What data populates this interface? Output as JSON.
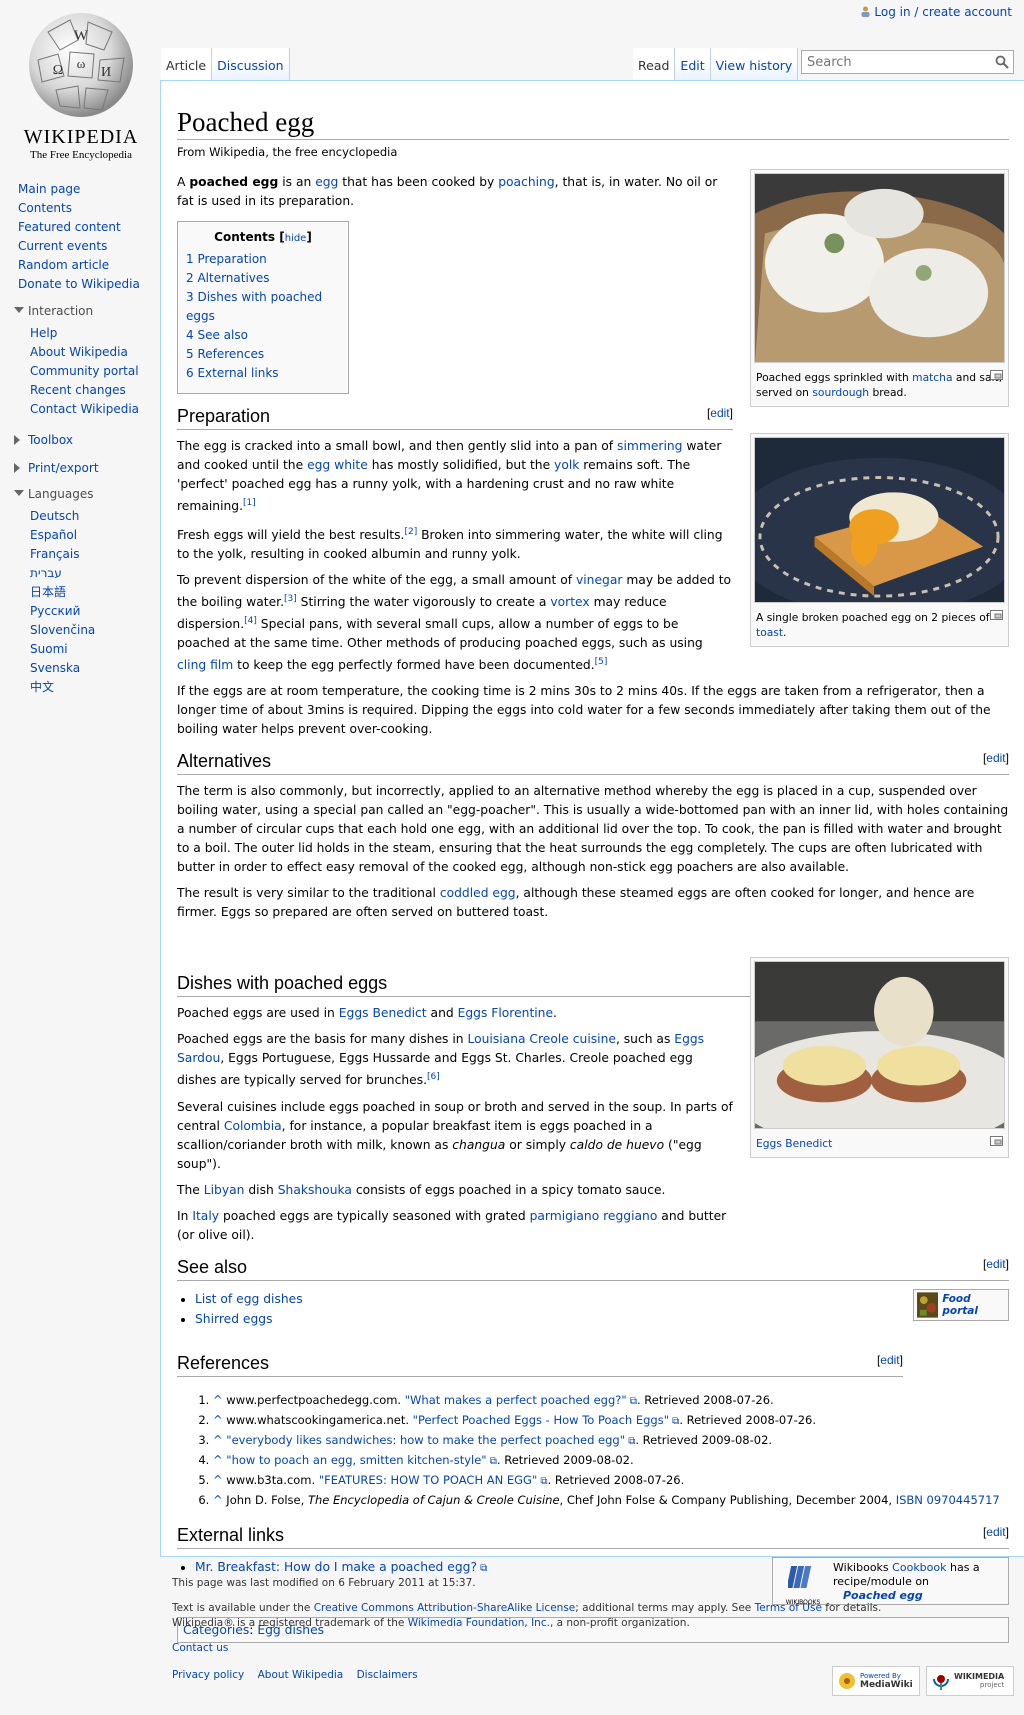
{
  "user": {
    "login": "Log in / create account"
  },
  "logo": {
    "wordmark": "Wikipedia",
    "tagline": "The Free Encyclopedia"
  },
  "tabs": {
    "article": "Article",
    "discussion": "Discussion",
    "read": "Read",
    "edit": "Edit",
    "history": "View history"
  },
  "search": {
    "placeholder": "Search"
  },
  "sidebar": {
    "nav": [
      "Main page",
      "Contents",
      "Featured content",
      "Current events",
      "Random article",
      "Donate to Wikipedia"
    ],
    "interaction_label": "Interaction",
    "interaction": [
      "Help",
      "About Wikipedia",
      "Community portal",
      "Recent changes",
      "Contact Wikipedia"
    ],
    "toolbox": "Toolbox",
    "printexport": "Print/export",
    "languages_label": "Languages",
    "languages": [
      "Deutsch",
      "Español",
      "Français",
      "עברית",
      "日本語",
      "Русский",
      "Slovenčina",
      "Suomi",
      "Svenska",
      "中文"
    ]
  },
  "article": {
    "title": "Poached egg",
    "sub": "From Wikipedia, the free encyclopedia",
    "edit": "edit",
    "intro": {
      "a": "A ",
      "b": "poached egg",
      "c": " is an ",
      "d": "egg",
      "e": " that has been cooked by ",
      "f": "poaching",
      "g": ", that is, in water. No oil or fat is used in its preparation."
    },
    "toc": {
      "title": "Contents",
      "hide": "hide",
      "items": [
        "1 Preparation",
        "2 Alternatives",
        "3 Dishes with poached eggs",
        "4 See also",
        "5 References",
        "6 External links"
      ]
    },
    "prep": {
      "heading": "Preparation",
      "p1": {
        "a": "The egg is cracked into a small bowl, and then gently slid into a pan of ",
        "b": "simmering",
        "c": " water and cooked until the ",
        "d": "egg white",
        "e": " has mostly solidified, but the ",
        "f": "yolk",
        "g": " remains soft. The 'perfect' poached egg has a runny yolk, with a hardening crust and no raw white remaining.",
        "s": "[1]"
      },
      "p2": {
        "a": "Fresh eggs will yield the best results.",
        "s": "[2]",
        "b": " Broken into simmering water, the white will cling to the yolk, resulting in cooked albumin and runny yolk."
      },
      "p3": {
        "a": "To prevent dispersion of the white of the egg, a small amount of ",
        "b": "vinegar",
        "c": " may be added to the boiling water.",
        "s3": "[3]",
        "d": " Stirring the water vigorously to create a ",
        "e": "vortex",
        "f": " may reduce dispersion.",
        "s4": "[4]",
        "g": " Special pans, with several small cups, allow a number of eggs to be poached at the same time. Other methods of producing poached eggs, such as using ",
        "h": "cling film",
        "i": " to keep the egg perfectly formed have been documented.",
        "s5": "[5]"
      },
      "p4": "If the eggs are at room temperature, the cooking time is 2 mins 30s to 2 mins 40s. If the eggs are taken from a refrigerator, then a longer time of about 3mins is required. Dipping the eggs into cold water for a few seconds immediately after taking them out of the boiling water helps prevent over-cooking."
    },
    "alt": {
      "heading": "Alternatives",
      "p1": "The term is also commonly, but incorrectly, applied to an alternative method whereby the egg is placed in a cup, suspended over boiling water, using a special pan called an \"egg-poacher\". This is usually a wide-bottomed pan with an inner lid, with holes containing a number of circular cups that each hold one egg, with an additional lid over the top. To cook, the pan is filled with water and brought to a boil. The outer lid holds in the steam, ensuring that the heat surrounds the egg completely. The cups are often lubricated with butter in order to effect easy removal of the cooked egg, although non-stick egg poachers are also available.",
      "p2": {
        "a": "The result is very similar to the traditional ",
        "b": "coddled egg",
        "c": ", although these steamed eggs are often cooked for longer, and hence are firmer. Eggs so prepared are often served on buttered toast."
      }
    },
    "dishes": {
      "heading": "Dishes with poached eggs",
      "p1": {
        "a": "Poached eggs are used in ",
        "b": "Eggs Benedict",
        "c": " and ",
        "d": "Eggs Florentine",
        "e": "."
      },
      "p2": {
        "a": "Poached eggs are the basis for many dishes in ",
        "b": "Louisiana Creole cuisine",
        "c": ", such as ",
        "d": "Eggs Sardou",
        "e": ", Eggs Portuguese, Eggs Hussarde and Eggs St. Charles. Creole poached egg dishes are typically served for brunches.",
        "s": "[6]"
      },
      "p3": {
        "a": "Several cuisines include eggs poached in soup or broth and served in the soup. In parts of central ",
        "b": "Colombia",
        "c": ", for instance, a popular breakfast item is eggs poached in a scallion/coriander broth with milk, known as ",
        "d": "changua",
        "e": " or simply ",
        "f": "caldo de huevo",
        "g": " (\"egg soup\")."
      },
      "p4": {
        "a": "The ",
        "b": "Libyan",
        "c": " dish ",
        "d": "Shakshouka",
        "e": " consists of eggs poached in a spicy tomato sauce."
      },
      "p5": {
        "a": "In ",
        "b": "Italy",
        "c": " poached eggs are typically seasoned with grated ",
        "d": "parmigiano reggiano",
        "e": " and butter (or olive oil)."
      }
    },
    "see": {
      "heading": "See also",
      "items": [
        "List of egg dishes",
        "Shirred eggs"
      ],
      "portal": "Food portal"
    },
    "refs": {
      "heading": "References",
      "items": [
        {
          "pre": "www.perfectpoachedegg.com. ",
          "link": "\"What makes a perfect poached egg?\"",
          "post": ". Retrieved 2008-07-26."
        },
        {
          "pre": "www.whatscookingamerica.net. ",
          "link": "\"Perfect Poached Eggs - How To Poach Eggs\"",
          "post": ". Retrieved 2008-07-26."
        },
        {
          "pre": "",
          "link": "\"everybody likes sandwiches: how to make the perfect poached egg\"",
          "post": ". Retrieved 2009-08-02."
        },
        {
          "pre": "",
          "link": "\"how to poach an egg, smitten kitchen-style\"",
          "post": ". Retrieved 2009-08-02."
        },
        {
          "pre": "www.b3ta.com. ",
          "link": "\"FEATURES: HOW TO POACH AN EGG\"",
          "post": ". Retrieved 2008-07-26."
        }
      ],
      "r6": {
        "a": "John D. Folse, ",
        "b": "The Encyclopedia of Cajun & Creole Cuisine",
        "c": ", Chef John Folse & Company Publishing, December 2004, ",
        "d": "ISBN 0970445717"
      },
      "caret": "^"
    },
    "ext": {
      "heading": "External links",
      "item": "Mr. Breakfast: How do I make a poached egg?",
      "wb": {
        "a": "Wikibooks ",
        "b": "Cookbook",
        "c": " has a recipe/module on",
        "d": "Poached egg",
        "logo": "WIKIBOOKS"
      }
    },
    "cats": {
      "label": "Categories",
      "item": "Egg dishes"
    }
  },
  "images": {
    "cap1": {
      "a": "Poached eggs sprinkled with ",
      "b": "matcha",
      "c": " and salt, served on ",
      "d": "sourdough",
      "e": " bread."
    },
    "cap2": {
      "a": "A single broken poached egg on 2 pieces of ",
      "b": "toast",
      "c": "."
    },
    "cap3": "Eggs Benedict"
  },
  "footer": {
    "modified": "This page was last modified on 6 February 2011 at 15:37.",
    "lic": {
      "a": "Text is available under the ",
      "b": "Creative Commons Attribution-ShareAlike License",
      "c": "; additional terms may apply. See ",
      "d": "Terms of Use",
      "e": " for details."
    },
    "tm": {
      "a": "Wikipedia® is a registered trademark of the ",
      "b": "Wikimedia Foundation, Inc.",
      "c": ", a non-profit organization."
    },
    "contact": "Contact us",
    "links": [
      "Privacy policy",
      "About Wikipedia",
      "Disclaimers"
    ],
    "badge1": {
      "a": "Powered By",
      "b": "MediaWiki"
    },
    "badge2": {
      "a": "WIKIMEDIA",
      "b": "project"
    }
  }
}
